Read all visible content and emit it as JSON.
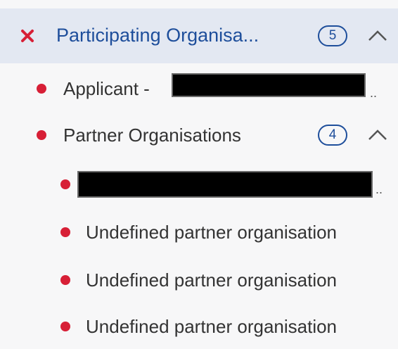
{
  "section": {
    "title": "Participating Organisa...",
    "count": "5",
    "status_icon": "x-icon",
    "status_color": "#d71f36",
    "expand_icon": "chevron-up-icon"
  },
  "applicant": {
    "label": "Applicant -",
    "truncation": ".."
  },
  "partners": {
    "label": "Partner Organisations",
    "count": "4",
    "expand_icon": "chevron-up-icon",
    "items": [
      {
        "label": "",
        "redacted": true,
        "truncation": ".."
      },
      {
        "label": "Undefined partner organisation"
      },
      {
        "label": "Undefined partner organisation"
      },
      {
        "label": "Undefined partner organisation"
      }
    ]
  },
  "colors": {
    "accent": "#1e4e9b",
    "dot": "#d71f36",
    "header_bg": "#e3e8f2"
  }
}
